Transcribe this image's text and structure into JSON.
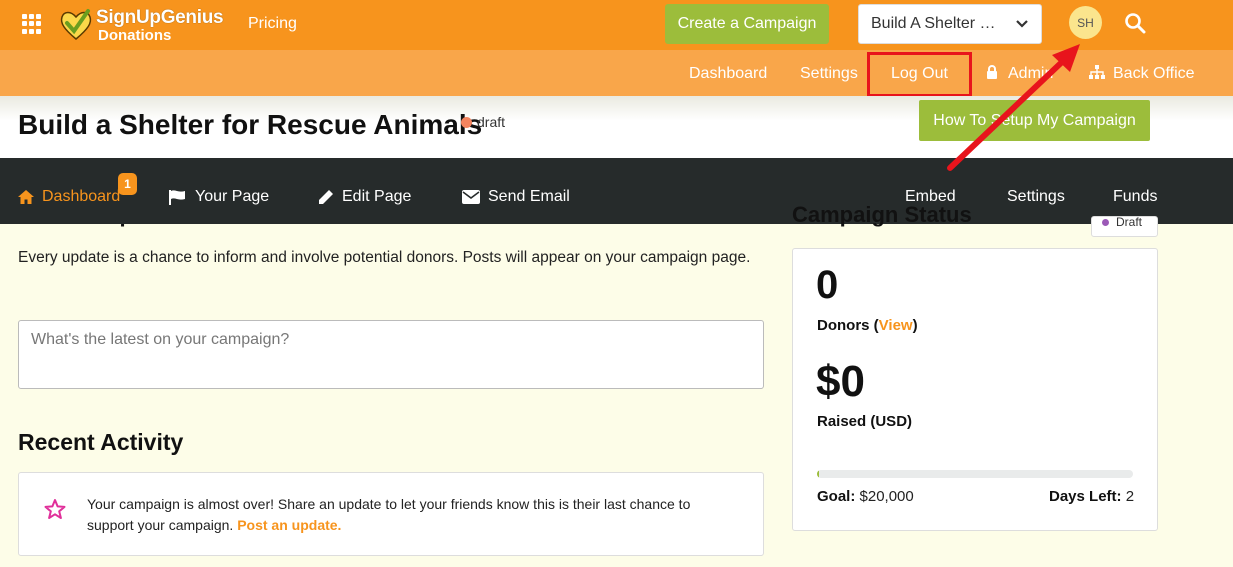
{
  "topbar": {
    "brand_line1": "SignUpGenius",
    "brand_line2": "Donations",
    "pricing_label": "Pricing",
    "create_campaign_label": "Create a Campaign",
    "campaign_select_value": "Build A Shelter …",
    "avatar_initials": "SH"
  },
  "subnav": {
    "dashboard": "Dashboard",
    "settings": "Settings",
    "logout": "Log Out",
    "admin": "Admin",
    "back_office": "Back Office"
  },
  "page": {
    "title": "Build a Shelter for Rescue Animals",
    "status": "draft",
    "howto_label": "How To Setup My Campaign"
  },
  "tabs": {
    "dashboard": "Dashboard",
    "dashboard_badge": "1",
    "your_page": "Your Page",
    "edit_page": "Edit Page",
    "send_email": "Send Email",
    "embed": "Embed",
    "settings": "Settings",
    "funds": "Funds"
  },
  "post_update": {
    "heading": "Post an Update",
    "intro": "Every update is a chance to inform and involve potential donors. Posts will appear on your campaign page.",
    "placeholder": "What's the latest on your campaign?"
  },
  "recent_activity": {
    "heading": "Recent Activity",
    "message": "Your campaign is almost over! Share an update to let your friends know this is their last chance to support your campaign.",
    "link": "Post an update."
  },
  "campaign_status": {
    "heading": "Campaign Status",
    "pill": "Draft",
    "donors_count": "0",
    "donors_label": "Donors (",
    "donors_view": "View",
    "donors_close": ")",
    "raised_amount": "$0",
    "raised_label": "Raised (USD)",
    "progress_percent": 0.5,
    "goal_label": "Goal:",
    "goal_value": "$20,000",
    "days_label": "Days Left:",
    "days_value": "2"
  },
  "colors": {
    "orange": "#f7941d",
    "light_orange": "#f9a64a",
    "green": "#9cbd3b",
    "dark_nav": "#262b2b",
    "highlight_red": "#e8141c"
  }
}
